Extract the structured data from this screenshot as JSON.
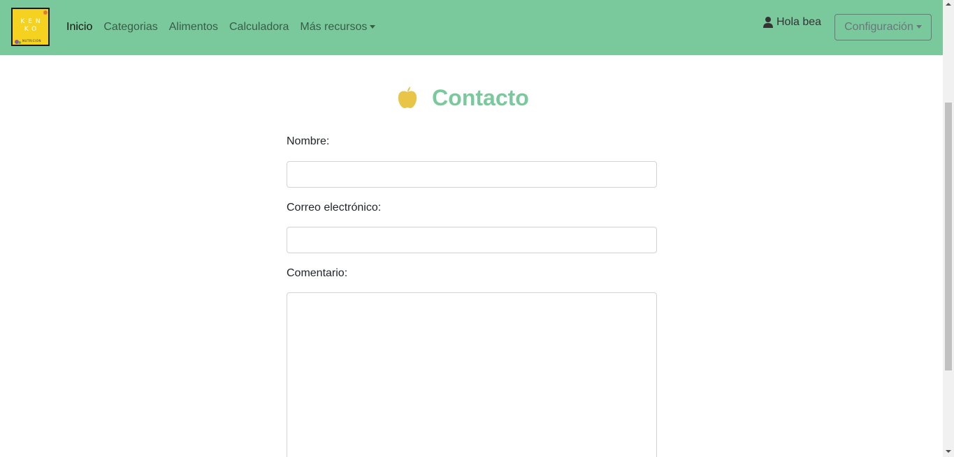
{
  "brand": {
    "logo_text_line1": "KEN",
    "logo_text_line2": "KO",
    "logo_tagline": "NUTRICIÓN"
  },
  "nav": {
    "items": [
      {
        "label": "Inicio",
        "active": true
      },
      {
        "label": "Categorias"
      },
      {
        "label": "Alimentos"
      },
      {
        "label": "Calculadora"
      },
      {
        "label": "Más recursos",
        "dropdown": true
      }
    ]
  },
  "user": {
    "greeting": "Hola bea",
    "icon": "user-icon"
  },
  "config": {
    "label": "Configuración"
  },
  "page": {
    "title": "Contacto",
    "icon": "apple-icon"
  },
  "form": {
    "name_label": "Nombre:",
    "name_value": "",
    "email_label": "Correo electrónico:",
    "email_value": "",
    "comment_label": "Comentario:",
    "comment_value": ""
  },
  "colors": {
    "navbar": "#7ac99c",
    "title": "#7ac99c",
    "apple": "#e8c547",
    "logo_bg": "#f4d21f"
  }
}
